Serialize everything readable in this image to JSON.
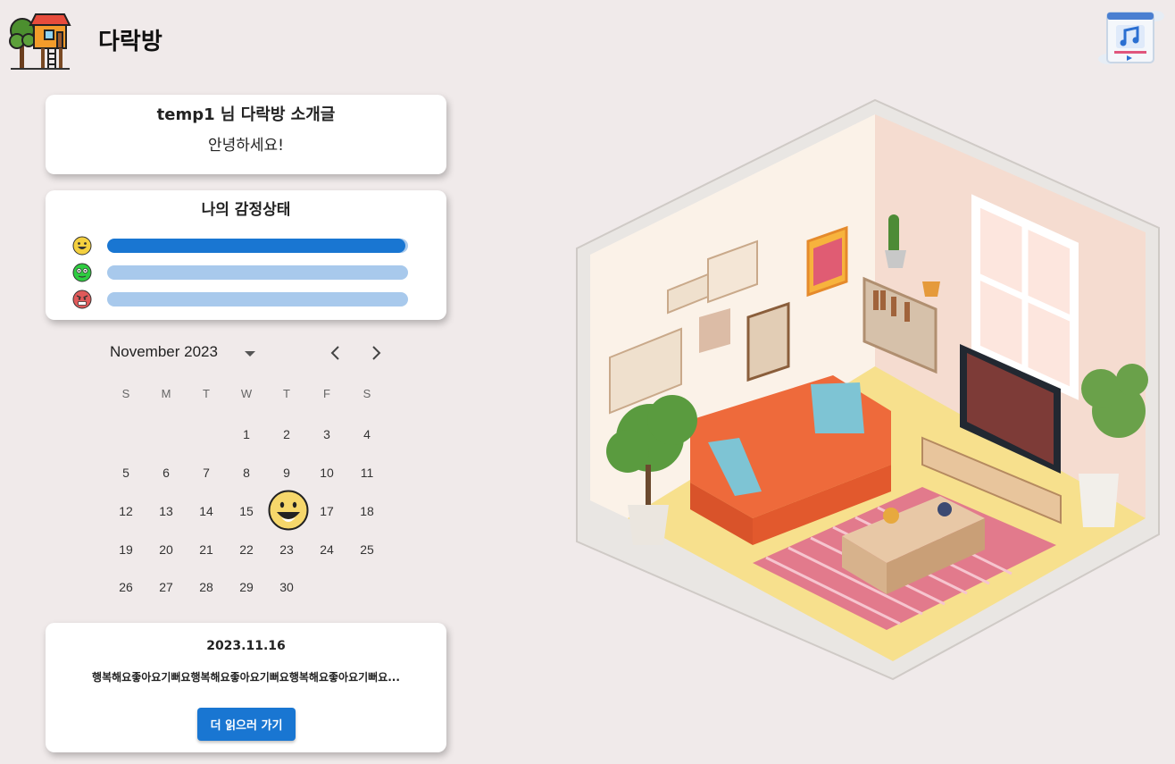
{
  "header": {
    "title": "다락방",
    "logo_icon": "treehouse-icon",
    "music_icon": "music-player-icon"
  },
  "intro": {
    "heading": "temp1 님 다락방 소개글",
    "text": "안녕하세요!"
  },
  "emotion": {
    "heading": "나의 감정상태",
    "items": [
      {
        "icon": "happy-face-icon",
        "color": "#f4d03f",
        "level": 0.99
      },
      {
        "icon": "calm-face-icon",
        "color": "#2ecc40",
        "level": 0.0
      },
      {
        "icon": "angry-face-icon",
        "color": "#e05a5a",
        "level": 0.0
      }
    ]
  },
  "calendar": {
    "month_label": "November 2023",
    "weekdays": [
      "S",
      "M",
      "T",
      "W",
      "T",
      "F",
      "S"
    ],
    "days": [
      "1",
      "2",
      "3",
      "4",
      "5",
      "6",
      "7",
      "8",
      "9",
      "10",
      "11",
      "12",
      "13",
      "14",
      "15",
      "16",
      "17",
      "18",
      "19",
      "20",
      "21",
      "22",
      "23",
      "24",
      "25",
      "26",
      "27",
      "28",
      "29",
      "30"
    ],
    "marked_day": "16",
    "marked_icon": "happy-face-icon"
  },
  "diary": {
    "date": "2023.11.16",
    "preview": "행복해요좋아요기뻐요행복해요좋아요기뻐요행복해요좋아요기뻐요...",
    "button_label": "더 읽으러 가기"
  },
  "illustration": {
    "name": "isometric-living-room"
  },
  "colors": {
    "background": "#f0eaea",
    "accent": "#1976d2",
    "track": "#a8c9ec"
  }
}
